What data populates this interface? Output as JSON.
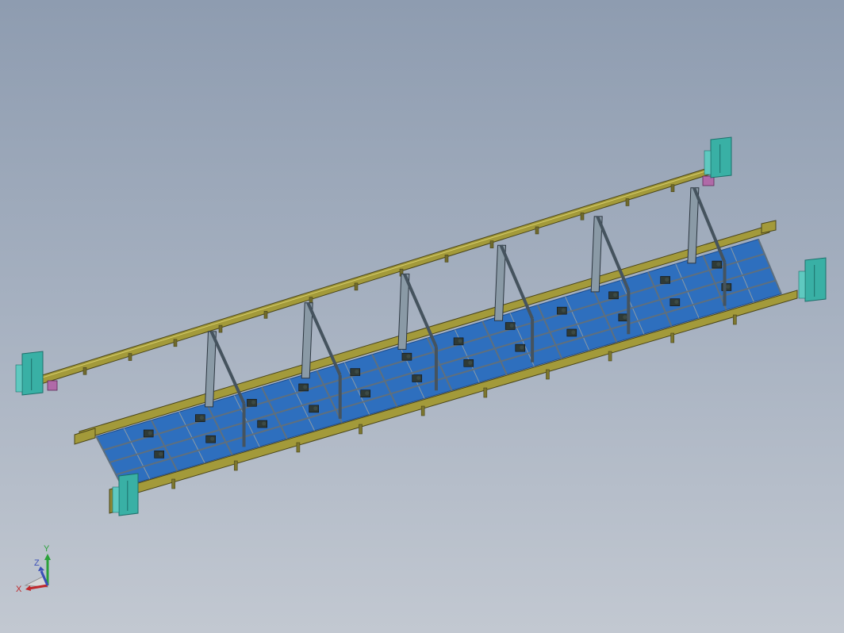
{
  "colors": {
    "background_top": "#8e9cb0",
    "background_bottom": "#c2c8d1",
    "rail_beam": "#a39a3a",
    "rail_edge": "#4a4518",
    "frame_steel": "#5e6f7e",
    "frame_steel_light": "#8a9aa6",
    "floor_blue": "#2e6fbe",
    "floor_blue_dark": "#1d4d8f",
    "clamp_dark": "#2f3a36",
    "control_cabinet": "#39b0a5",
    "control_cabinet_dark": "#1d6f6a",
    "motor_magenta": "#b06aa8",
    "axis_x": "#c0282b",
    "axis_y": "#2aa13a",
    "axis_z": "#3a4fb8"
  },
  "icons": {
    "control_cabinets": [
      "cabinet-icon",
      "cabinet-icon",
      "cabinet-icon",
      "cabinet-icon"
    ],
    "triad": "coordinate-triad-icon"
  },
  "triad": {
    "x_label": "X",
    "y_label": "Y",
    "z_label": "Z"
  },
  "model": {
    "upright_stations": 6,
    "floor_bays": 12,
    "rail_supports": 14
  }
}
